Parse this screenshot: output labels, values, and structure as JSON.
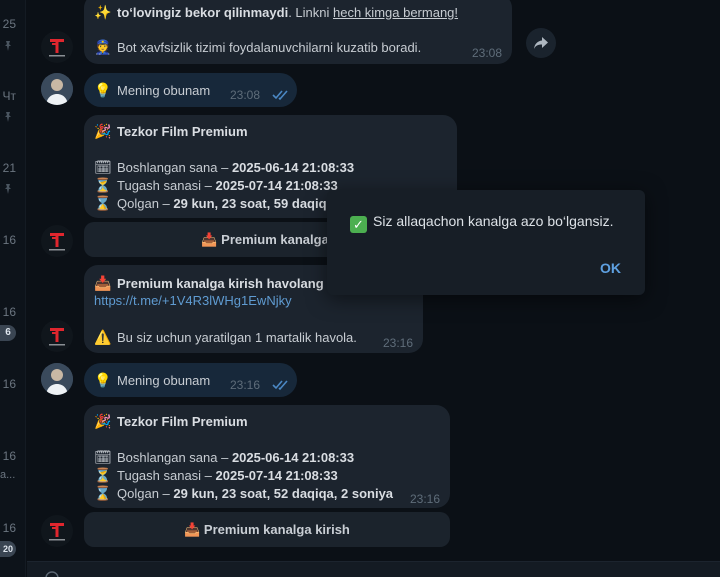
{
  "sidebar": {
    "times": [
      "25",
      "Чт",
      "21",
      "16",
      "16",
      "16",
      "16",
      "16"
    ],
    "badges": [
      "6",
      "20"
    ],
    "snippet": "a..."
  },
  "messages": {
    "m1": {
      "line1_bold": "to‘lovingiz bekor qilinmaydi",
      "line1_rest": ". Linkni ",
      "line1_link": "hech kimga bermang!",
      "line2": "Bot xavfsizlik tizimi foydalanuvchilarni kuzatib boradi.",
      "time": "23:08"
    },
    "m2": {
      "text": "Mening obunam",
      "time": "23:08"
    },
    "m3": {
      "title": "Tezkor Film Premium",
      "start_label": "Boshlangan sana – ",
      "start_value": "2025-06-14 21:08:33",
      "end_label": "Tugash sanasi – ",
      "end_value": "2025-07-14 21:08:33",
      "left_label": "Qolgan – ",
      "left_value": "29 kun, 23 soat, 59 daqiq",
      "button": "Premium kanalga k"
    },
    "m4": {
      "title": "Premium kanalga kirish havolang",
      "link": "https://t.me/+1V4R3lWHg1EwNjky",
      "note": "Bu siz uchun yaratilgan 1 martalik havola.",
      "time": "23:16"
    },
    "m5": {
      "text": "Mening obunam",
      "time": "23:16"
    },
    "m6": {
      "title": "Tezkor Film Premium",
      "start_label": "Boshlangan sana – ",
      "start_value": "2025-06-14 21:08:33",
      "end_label": "Tugash sanasi – ",
      "end_value": "2025-07-14 21:08:33",
      "left_label": "Qolgan – ",
      "left_value": "29 kun, 23 soat, 52 daqiqa, 2 soniya",
      "time": "23:16",
      "button": "Premium kanalga kirish"
    }
  },
  "dialog": {
    "message": "Siz allaqachon kanalga azo bo‘lgansiz.",
    "ok": "OK"
  },
  "colors": {
    "accent": "#5ea0e0",
    "link": "#5f9bd1",
    "bubble": "#1c242e",
    "own_bubble": "#17283a"
  }
}
